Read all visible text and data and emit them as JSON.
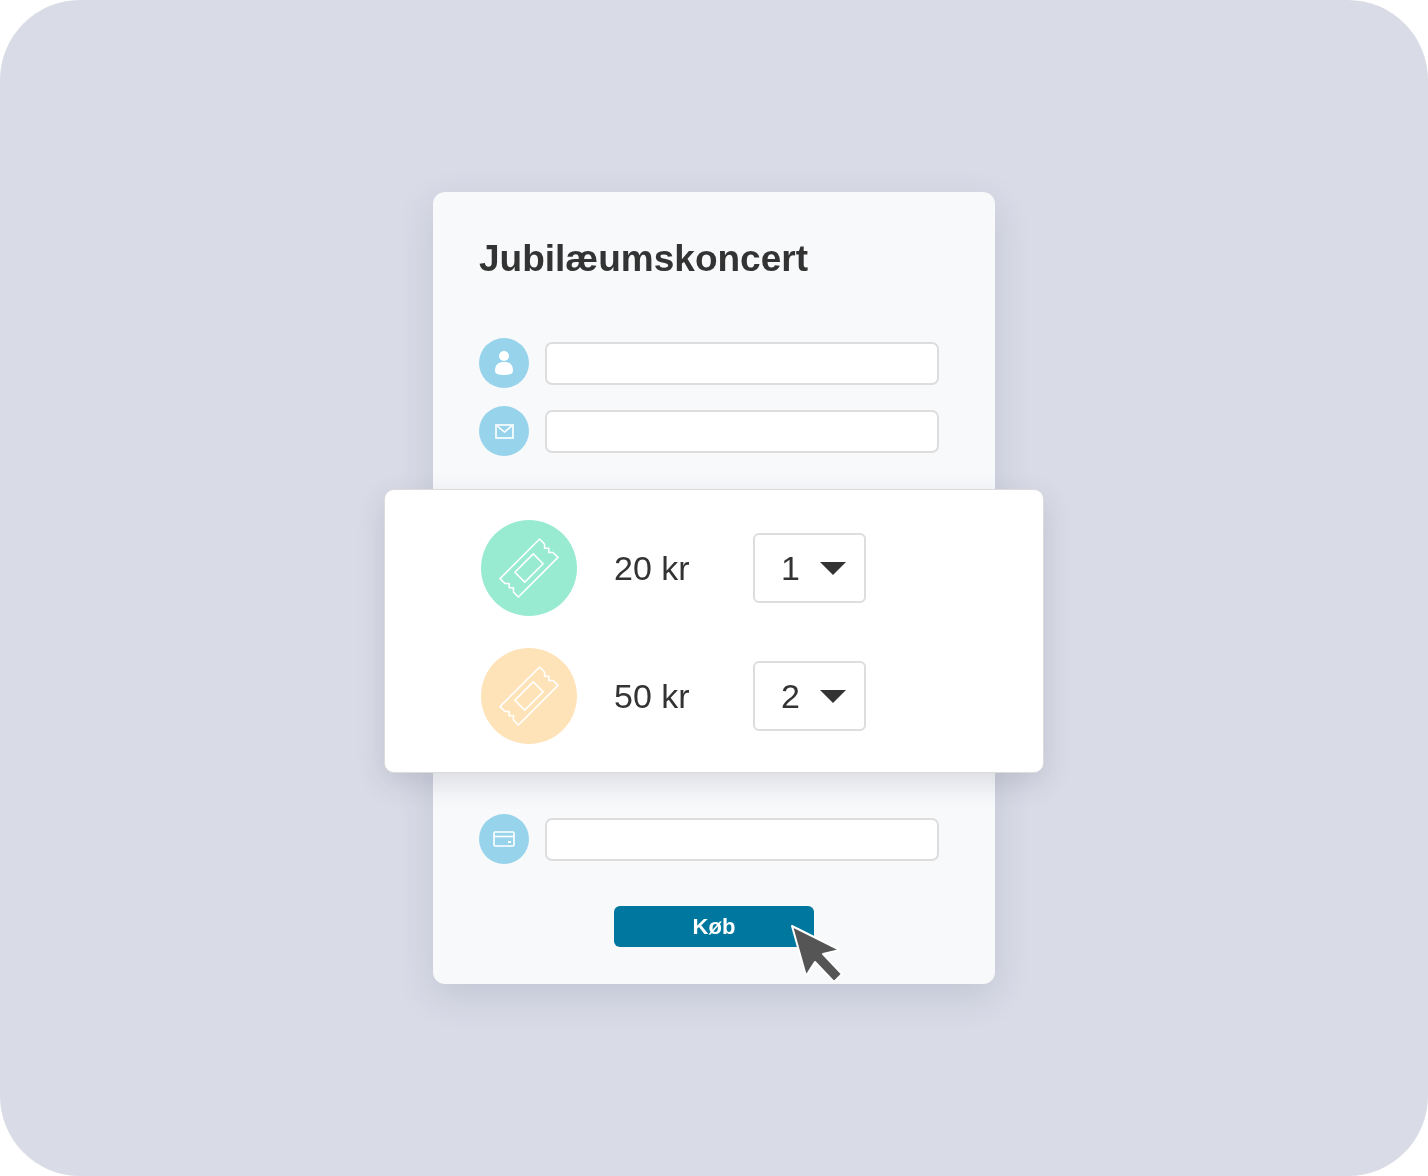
{
  "form": {
    "title": "Jubilæumskoncert",
    "contact_fields": [
      {
        "kind": "person"
      },
      {
        "kind": "email"
      }
    ],
    "tickets": [
      {
        "price": "20 kr",
        "quantity": "1",
        "color": "#98ebd0"
      },
      {
        "price": "50 kr",
        "quantity": "2",
        "color": "#ffe3b8"
      }
    ],
    "payment_field": {
      "kind": "card"
    },
    "submit_button": "Køb"
  }
}
